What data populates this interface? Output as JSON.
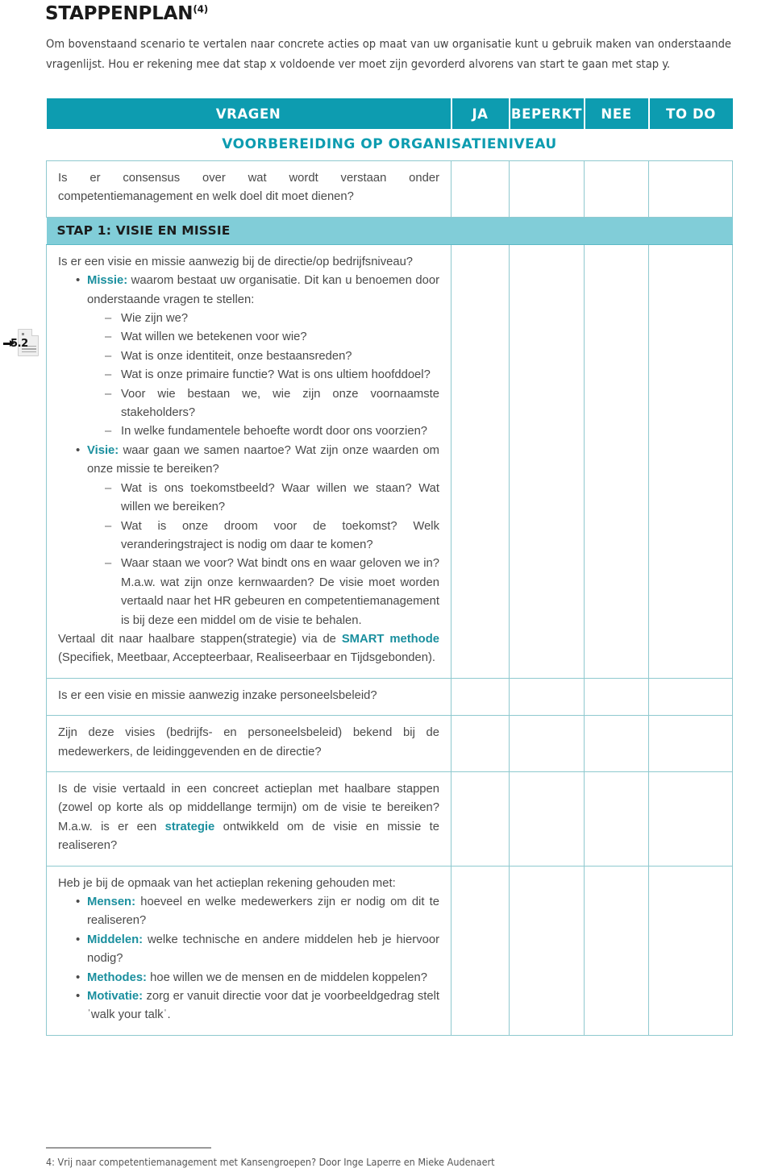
{
  "title": {
    "text": "STAPPENPLAN",
    "superscript": "(4)"
  },
  "intro": "Om bovenstaand scenario te vertalen naar concrete acties op maat van uw organisatie kunt u gebruik maken van onderstaande vragenlijst. Hou er rekening mee dat stap x voldoende ver moet zijn gevorderd alvorens van start te gaan met stap y.",
  "colors": {
    "header_teal": "#0d9cb0",
    "band_teal": "#81cdd8",
    "accent_teal": "#1a8f9e",
    "grid_line": "#8fc9cf"
  },
  "table": {
    "headers": {
      "questions": "VRAGEN",
      "yes": "JA",
      "limited": "BEPERKT",
      "no": "NEE",
      "todo": "TO DO"
    },
    "section_title": "VOORBEREIDING OP ORGANISATIENIVEAU",
    "step_band": "STAP 1: VISIE EN MISSIE",
    "rows": {
      "consensus": "Is er consensus over wat wordt verstaan onder competentiemanagement en welk doel dit moet dienen?",
      "vision_intro": "Is er een visie en missie aanwezig bij de directie/op bedrijfsniveau?",
      "missie_label": "Missie:",
      "missie_text": " waarom bestaat uw organisatie. Dit kan u benoemen door onderstaande vragen te stellen:",
      "missie_subs": [
        "Wie zijn we?",
        "Wat willen we betekenen voor wie?",
        "Wat is onze identiteit, onze bestaansreden?",
        "Wat is onze primaire functie? Wat is ons ultiem hoofddoel?",
        "Voor wie bestaan we, wie zijn onze voornaamste stakeholders?",
        "In welke fundamentele behoefte wordt door ons voorzien?"
      ],
      "visie_label": "Visie:",
      "visie_text": " waar gaan we samen naartoe? Wat zijn onze waarden om onze missie te bereiken?",
      "visie_subs": [
        "Wat is ons toekomstbeeld? Waar willen we staan? Wat willen we bereiken?",
        "Wat is onze droom voor de toekomst? Welk veranderingstraject is nodig om daar te komen?",
        "Waar staan we voor? Wat bindt ons en waar geloven we in? M.a.w. wat zijn onze kernwaarden? De visie moet worden vertaald naar het HR gebeuren en competentiemanagement is bij deze een middel om de visie te behalen."
      ],
      "smart_pre": "Vertaal dit naar haalbare stappen(strategie) via de ",
      "smart_label": "SMART methode",
      "smart_post": " (Specifiek, Meetbaar, Accepteerbaar, Realiseerbaar en Tijdsgebonden).",
      "personeelsbeleid": "Is er een visie en missie aanwezig inzake personeelsbeleid?",
      "bekend": "Zijn deze visies (bedrijfs- en personeelsbeleid) bekend bij de medewerkers, de leidinggevenden en de directie?",
      "actieplan_pre": "Is de visie vertaald in een concreet actieplan met haalbare stappen (zowel op korte als op middellange termijn) om de visie te bereiken? M.a.w. is er een ",
      "actieplan_label": "strategie",
      "actieplan_post": " ontwikkeld om de visie en missie te realiseren?",
      "opmaak_intro": "Heb je bij de opmaak van het actieplan rekening gehouden met:",
      "opmaak_items": [
        {
          "label": "Mensen:",
          "text": " hoeveel en welke medewerkers zijn er nodig om dit te realiseren?"
        },
        {
          "label": "Middelen:",
          "text": " welke technische en andere middelen heb je hiervoor nodig?"
        },
        {
          "label": "Methodes:",
          "text": " hoe willen we de mensen en de middelen koppelen?"
        },
        {
          "label": "Motivatie:",
          "text": " zorg er vanuit directie voor dat je voorbeeldgedrag stelt ˈwalk your talkˈ."
        }
      ]
    }
  },
  "margin_icon": {
    "label": "5.2"
  },
  "footnote": "4: Vrij naar competentiemanagement met Kansengroepen? Door Inge Laperre en Mieke Audenaert"
}
